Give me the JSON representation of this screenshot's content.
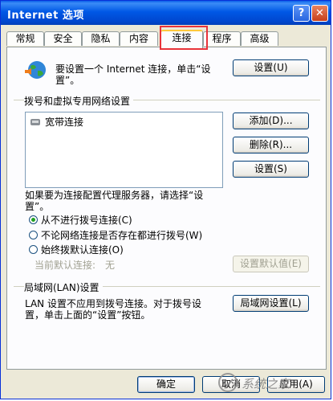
{
  "window": {
    "title": "Internet 选项",
    "help": "?",
    "close": "✕"
  },
  "tabs": [
    "常规",
    "安全",
    "隐私",
    "内容",
    "连接",
    "程序",
    "高级"
  ],
  "active_tab": "连接",
  "setup": {
    "text_line1": "要设置一个 Internet 连接，单击“设",
    "text_line2": "置”。",
    "button": "设置(U)"
  },
  "dialup": {
    "header": "拨号和虚拟专用网络设置",
    "items": [
      "宽带连接"
    ],
    "add": "添加(D)...",
    "remove": "删除(R)...",
    "settings": "设置(S)"
  },
  "proxy_text_line1": "如果要为连接配置代理服务器，请选择“设",
  "proxy_text_line2": "置”。",
  "radios": [
    {
      "label": "从不进行拨号连接(C)",
      "checked": true
    },
    {
      "label": "不论网络连接是否存在都进行拨号(W)",
      "checked": false
    },
    {
      "label": "始终拨默认连接(O)",
      "checked": false
    }
  ],
  "current_default": {
    "label": "当前默认连接:",
    "value": "无",
    "button": "设置默认值(E)"
  },
  "lan": {
    "header": "局域网(LAN)设置",
    "text_line1": "LAN 设置不应用到拨号连接。对于拨号设",
    "text_line2": "置，单击上面的“设置”按钮。",
    "button": "局域网设置(L)"
  },
  "footer": {
    "ok": "确定",
    "cancel": "取消",
    "apply": "应用(A)"
  },
  "watermark": "系统之家"
}
